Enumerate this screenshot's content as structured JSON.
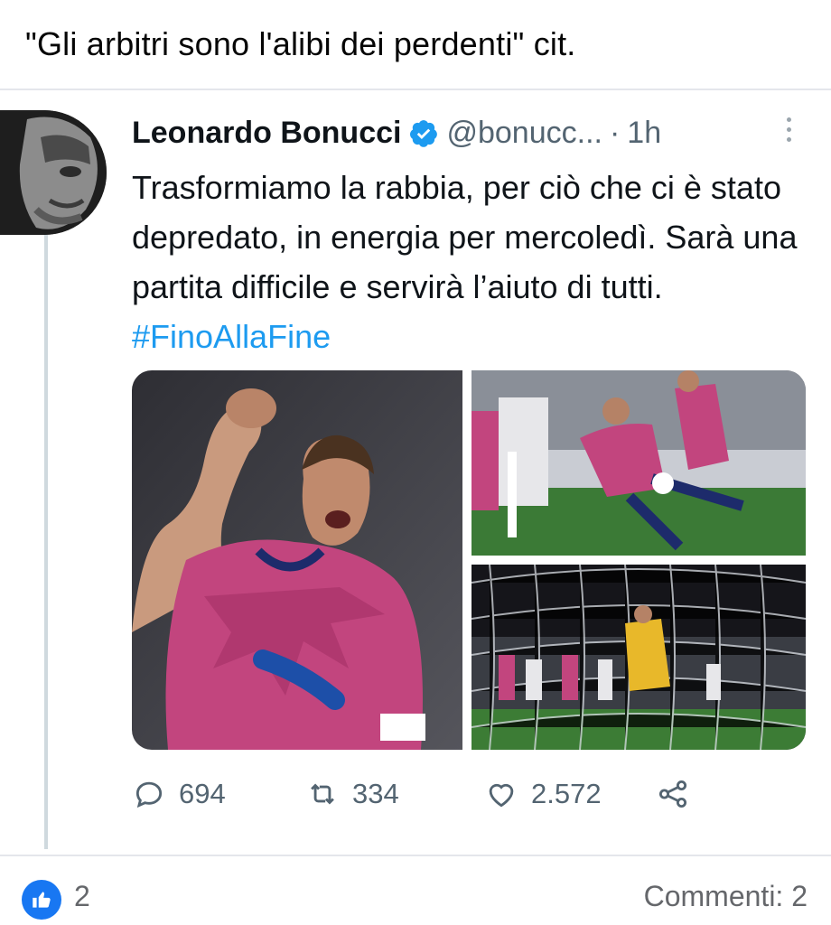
{
  "post": {
    "text": "\"Gli arbitri sono l'alibi dei perdenti\" cit."
  },
  "tweet": {
    "name": "Leonardo Bonucci",
    "handle": "@bonucc...",
    "separator": "·",
    "time": "1h",
    "body_text": "Trasformiamo la rabbia, per ciò che ci è stato depredato, in energia per mercoledì. Sarà una partita difficile e servirà l’aiuto di tutti. ",
    "hashtag": "#FinoAllaFine",
    "replies": "694",
    "retweets": "334",
    "likes": "2.572",
    "colors": {
      "link": "#1d9bf0",
      "verified": "#1d9bf0",
      "muted": "#536471",
      "jersey_pink": "#c2457e"
    },
    "icons": {
      "verified": "verified-badge-icon",
      "reply": "reply-bubble-icon",
      "retweet": "retweet-icon",
      "like": "heart-icon",
      "share": "share-icon",
      "more": "more-options-icon"
    }
  },
  "footer": {
    "reactions_count": "2",
    "comments_label": "Commenti: 2",
    "like_color": "#1877f2"
  }
}
